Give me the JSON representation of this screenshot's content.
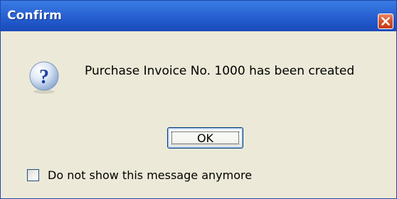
{
  "window": {
    "title": "Confirm",
    "close_icon": "close-icon",
    "accent": "#2c67d6",
    "close_color": "#d9542e"
  },
  "message": {
    "icon": "question-icon",
    "text": "Purchase Invoice No. 1000 has been created"
  },
  "buttons": {
    "ok_label": "OK"
  },
  "option": {
    "label": "Do not show this message anymore",
    "checked": false
  }
}
